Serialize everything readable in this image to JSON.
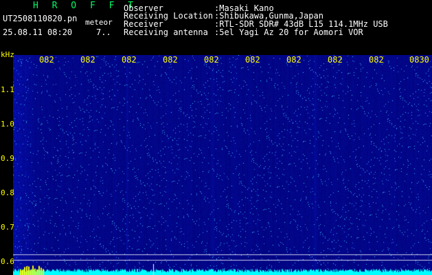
{
  "header": {
    "title": "H R O F F T",
    "file_name": "UT2508110820.pn",
    "file_tag": "meteor",
    "datetime": "25.08.11 08:20",
    "count": "7.."
  },
  "info": [
    {
      "label": "Observer",
      "value": ":Masaki Kano"
    },
    {
      "label": "Receiving Location",
      "value": ":Shibukawa,Gunma,Japan"
    },
    {
      "label": "Receiver",
      "value": ":RTL-SDR SDR# 43dB L15 114.1MHz USB"
    },
    {
      "label": "Receiving antenna",
      "value": ":5el Yagi Az 20 for Aomori VOR"
    }
  ],
  "axis": {
    "y_unit": "kHz",
    "y_ticks": [
      "1.1",
      "1.0",
      "0.9",
      "0.8",
      "0.7",
      "0.6"
    ],
    "x_ticks": [
      "082",
      "082",
      "082",
      "082",
      "082",
      "082",
      "082",
      "082",
      "082",
      "0830"
    ]
  },
  "colors": {
    "background": "#000000",
    "title": "#00ff66",
    "info_text": "#ffffff",
    "axis_text": "#ffff00",
    "spectrogram_base": "#0a1560",
    "signal": "#00ffff"
  }
}
